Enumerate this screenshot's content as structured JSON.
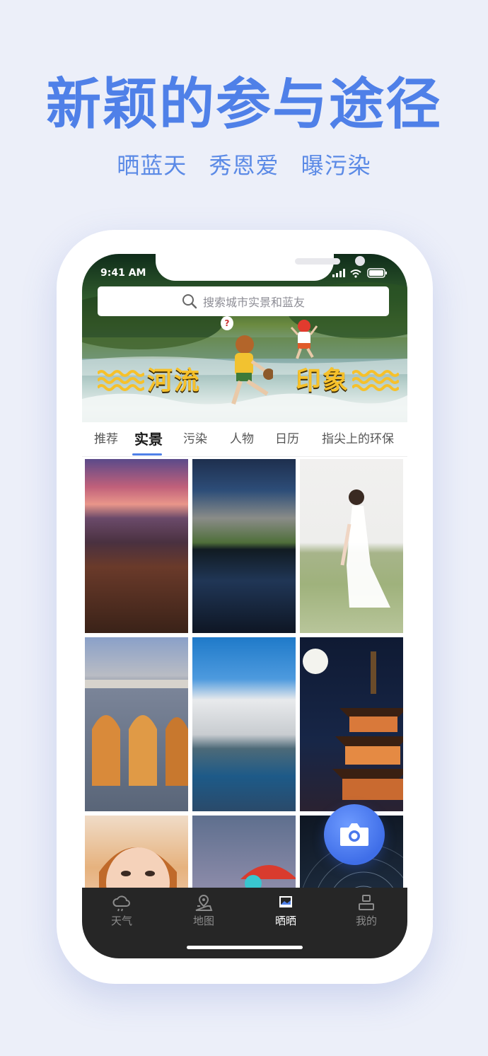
{
  "headline": "新颖的参与途径",
  "sublines": [
    "晒蓝天",
    "秀恩爱",
    "曝污染"
  ],
  "status": {
    "time": "9:41 AM"
  },
  "search": {
    "placeholder": "搜索城市实景和蓝友"
  },
  "banner": {
    "left_text": "河流",
    "right_text": "印象",
    "bubble": "?"
  },
  "tabs": [
    {
      "label": "推荐",
      "active": false
    },
    {
      "label": "实景",
      "active": true
    },
    {
      "label": "污染",
      "active": false
    },
    {
      "label": "人物",
      "active": false
    },
    {
      "label": "日历",
      "active": false
    },
    {
      "label": "指尖上的环保",
      "active": false
    }
  ],
  "photos": [
    {
      "subject": "sunset-rocky-coast"
    },
    {
      "subject": "mountain-lake-reflection"
    },
    {
      "subject": "woman-in-white-dress-on-grass"
    },
    {
      "subject": "seventeen-arch-bridge"
    },
    {
      "subject": "terraced-fields-in-fog"
    },
    {
      "subject": "pagoda-under-full-moon"
    },
    {
      "subject": "girl-portrait"
    },
    {
      "subject": "blurred-red-umbrella"
    },
    {
      "subject": "star-trails"
    }
  ],
  "camera_button": {
    "icon": "camera-icon"
  },
  "tabbar": [
    {
      "label": "天气",
      "icon": "cloud-icon",
      "active": false
    },
    {
      "label": "地图",
      "icon": "map-pin-icon",
      "active": false
    },
    {
      "label": "晒晒",
      "icon": "photo-icon",
      "active": true
    },
    {
      "label": "我的",
      "icon": "person-icon",
      "active": false
    }
  ],
  "colors": {
    "accent": "#4f80e8",
    "tabbar_bg": "#262626",
    "page_bg": "#eceff9"
  }
}
